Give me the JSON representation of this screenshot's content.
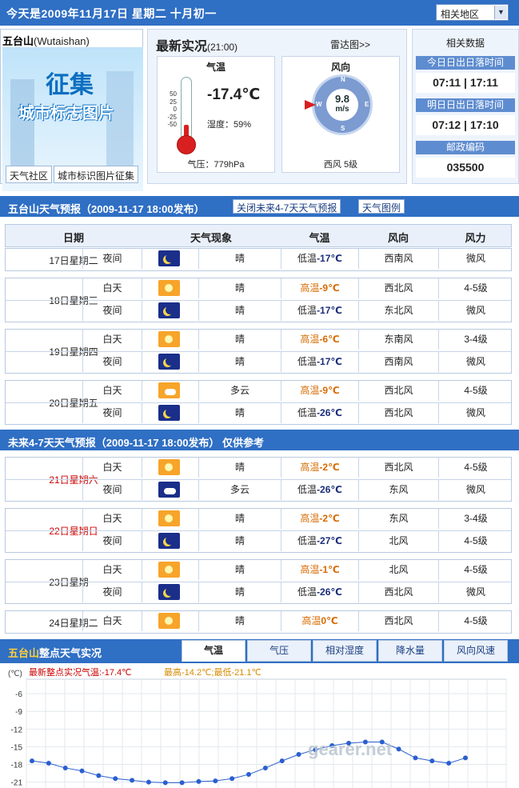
{
  "top": {
    "date": "今天是2009年11月17日  星期二  十月初一",
    "region_select": "相关地区"
  },
  "city": {
    "name": "五台山",
    "pinyin": "(Wutaishan)",
    "banner1": "征集",
    "banner2": "城市标志图片",
    "btn1": "天气社区",
    "btn2": "城市标识图片征集"
  },
  "now": {
    "title": "最新实况",
    "time": "(21:00)",
    "radar": "雷达图>>",
    "temp_head": "气温",
    "temp": "-17.4℃",
    "humidity": "湿度：59%",
    "pressure": "气压：779hPa",
    "ticks": [
      "50",
      "25",
      "0",
      "-25",
      "-50"
    ],
    "temp_level": 0.25,
    "wind_head": "风向",
    "wind_speed": "9.8",
    "wind_unit": "m/s",
    "wind_desc": "西风  5级",
    "dirs": {
      "n": "N",
      "e": "E",
      "s": "S",
      "w": "W"
    }
  },
  "related": {
    "title": "相关数据",
    "today_bar": "今日日出日落时间",
    "today_val": "07:11 | 17:11",
    "tomorrow_bar": "明日日出日落时间",
    "tomorrow_val": "07:12 | 17:10",
    "post_bar": "邮政编码",
    "post_val": "035500"
  },
  "forecast": {
    "title": "五台山天气预报（2009-11-17 18:00发布）",
    "btn_close": "关闭未来4-7天天气预报",
    "btn_legend": "天气图例",
    "headers": [
      "日期",
      "天气现象",
      "气温",
      "风向",
      "风力"
    ],
    "groups": [
      {
        "date": "17日星期二",
        "rows": [
          {
            "p": "夜间",
            "icon": "moon",
            "w": "晴",
            "tl": "低温",
            "tv": "-17℃",
            "t": "lo",
            "wd": "西南风",
            "wf": "微风"
          }
        ]
      },
      {
        "date": "18日星期三",
        "rows": [
          {
            "p": "白天",
            "icon": "sun",
            "w": "晴",
            "tl": "高温",
            "tv": "-9℃",
            "t": "hi",
            "wd": "西北风",
            "wf": "4-5级"
          },
          {
            "p": "夜间",
            "icon": "moon",
            "w": "晴",
            "tl": "低温",
            "tv": "-17℃",
            "t": "lo",
            "wd": "东北风",
            "wf": "微风"
          }
        ]
      },
      {
        "date": "19日星期四",
        "rows": [
          {
            "p": "白天",
            "icon": "sun",
            "w": "晴",
            "tl": "高温",
            "tv": "-6℃",
            "t": "hi",
            "wd": "东南风",
            "wf": "3-4级"
          },
          {
            "p": "夜间",
            "icon": "moon",
            "w": "晴",
            "tl": "低温",
            "tv": "-17℃",
            "t": "lo",
            "wd": "西南风",
            "wf": "微风"
          }
        ]
      },
      {
        "date": "20日星期五",
        "rows": [
          {
            "p": "白天",
            "icon": "cloud",
            "w": "多云",
            "tl": "高温",
            "tv": "-9℃",
            "t": "hi",
            "wd": "西北风",
            "wf": "4-5级"
          },
          {
            "p": "夜间",
            "icon": "moon",
            "w": "晴",
            "tl": "低温",
            "tv": "-26℃",
            "t": "lo",
            "wd": "西北风",
            "wf": "微风"
          }
        ]
      }
    ]
  },
  "future": {
    "title": "未来4-7天天气预报（2009-11-17 18:00发布）   仅供参考",
    "groups": [
      {
        "date": "21日星期六",
        "red": true,
        "rows": [
          {
            "p": "白天",
            "icon": "sun",
            "w": "晴",
            "tl": "高温",
            "tv": "-2℃",
            "t": "hi",
            "wd": "西北风",
            "wf": "4-5级"
          },
          {
            "p": "夜间",
            "icon": "nc",
            "w": "多云",
            "tl": "低温",
            "tv": "-26℃",
            "t": "lo",
            "wd": "东风",
            "wf": "微风"
          }
        ]
      },
      {
        "date": "22日星期日",
        "red": true,
        "rows": [
          {
            "p": "白天",
            "icon": "sun",
            "w": "晴",
            "tl": "高温",
            "tv": "-2℃",
            "t": "hi",
            "wd": "东风",
            "wf": "3-4级"
          },
          {
            "p": "夜间",
            "icon": "moon",
            "w": "晴",
            "tl": "低温",
            "tv": "-27℃",
            "t": "lo",
            "wd": "北风",
            "wf": "4-5级"
          }
        ]
      },
      {
        "date": "23日星期一",
        "red": false,
        "rows": [
          {
            "p": "白天",
            "icon": "sun",
            "w": "晴",
            "tl": "高温",
            "tv": "-1℃",
            "t": "hi",
            "wd": "北风",
            "wf": "4-5级"
          },
          {
            "p": "夜间",
            "icon": "moon",
            "w": "晴",
            "tl": "低温",
            "tv": "-26℃",
            "t": "lo",
            "wd": "西北风",
            "wf": "微风"
          }
        ]
      },
      {
        "date": "24日星期二",
        "red": false,
        "rows": [
          {
            "p": "白天",
            "icon": "sun",
            "w": "晴",
            "tl": "高温",
            "tv": "0℃",
            "t": "hi",
            "wd": "西北风",
            "wf": "4-5级"
          }
        ]
      }
    ]
  },
  "hourly": {
    "title_city": "五台山",
    "title_rest": "整点天气实况",
    "tabs": [
      "气温",
      "气压",
      "相对湿度",
      "降水量",
      "风向风速"
    ],
    "latest": "最新整点实况气温:-17.4℃",
    "range": "最高-14.2℃;最低-21.1℃",
    "unit": "(℃)",
    "watermark": "gearer.net"
  },
  "chart_data": {
    "type": "line",
    "yticks": [
      -6,
      -9,
      -12,
      -15,
      -18,
      -21
    ],
    "ylim": [
      -22,
      -3
    ],
    "values": [
      -17.4,
      -17.8,
      -18.6,
      -19.1,
      -19.9,
      -20.4,
      -20.7,
      -21.0,
      -21.1,
      -21.1,
      -20.9,
      -20.8,
      -20.4,
      -19.7,
      -18.6,
      -17.4,
      -16.3,
      -15.5,
      -14.8,
      -14.4,
      -14.2,
      -14.2,
      -15.4,
      -16.9,
      -17.4,
      -17.8,
      -16.9
    ],
    "colors": {
      "line": "#2a5fd0",
      "point": "#2a5fd0"
    }
  }
}
